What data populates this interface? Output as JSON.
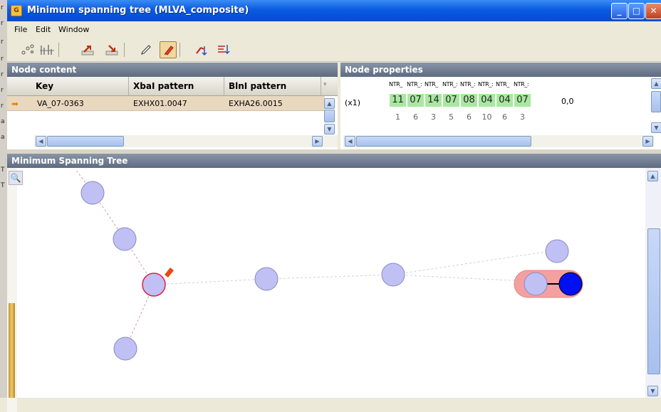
{
  "window": {
    "title": "Minimum spanning tree (MLVA_composite)"
  },
  "menu": {
    "items": [
      "File",
      "Edit",
      "Window"
    ]
  },
  "toolbar": {
    "icons": [
      "layout-nodes-icon",
      "sort-branches-icon",
      "export-icon",
      "import-icon",
      "pen-icon",
      "highlight-pin-icon",
      "node-tool-icon",
      "branch-tool-icon"
    ]
  },
  "node_content": {
    "title": "Node content",
    "columns": [
      "Key",
      "XbaI pattern",
      "BlnI pattern"
    ],
    "rows": [
      {
        "key": "VA_07-0363",
        "xbai": "EXHX01.0047",
        "blni": "EXHA26.0015"
      }
    ]
  },
  "node_properties": {
    "title": "Node properties",
    "column_labels": [
      "NTR_",
      "NTR_:",
      "NTR_",
      "NTR_:",
      "NTR_:",
      "NTR_:",
      "NTR_",
      "NTR_:"
    ],
    "count": "(x1)",
    "values": [
      "11",
      "07",
      "14",
      "07",
      "08",
      "04",
      "04",
      "07"
    ],
    "subvalues": [
      "1",
      "6",
      "3",
      "5",
      "6",
      "10",
      "6",
      "3"
    ],
    "tail": "0,0"
  },
  "mst": {
    "title": "Minimum Spanning Tree",
    "colors": {
      "node_fill": "#c0c0f4",
      "node_stroke": "#8888c0",
      "selected_stroke": "#e02040",
      "highlight": "#f4a0a0",
      "active_node": "#0010f0",
      "link": "#c8a0a8"
    }
  },
  "left_strip": {
    "fragments": [
      "r",
      "r",
      "r",
      "r",
      "r",
      "r",
      "r",
      "a",
      "a",
      "T",
      "T"
    ]
  }
}
